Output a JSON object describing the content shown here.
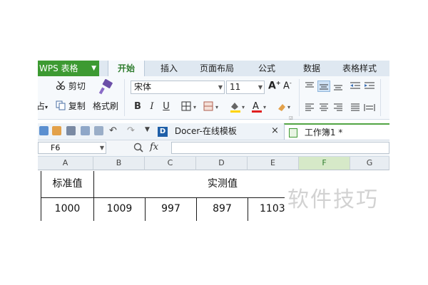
{
  "menubar": {
    "app_label": "WPS 表格",
    "tabs": [
      {
        "label": "开始"
      },
      {
        "label": "插入"
      },
      {
        "label": "页面布局"
      },
      {
        "label": "公式"
      },
      {
        "label": "数据"
      },
      {
        "label": "表格样式"
      }
    ]
  },
  "ribbon": {
    "cut_label": "剪切",
    "paste_label": "占",
    "copy_label": "复制",
    "format_painter_label": "格式刷",
    "font_name": "宋体",
    "font_size": "11"
  },
  "doc_tabs": {
    "docer_label": "Docer-在线模板",
    "close_glyph": "×",
    "workbook_label": "工作簿1 *"
  },
  "formula_bar": {
    "cell_ref": "F6",
    "fx_label": "fx"
  },
  "sheet": {
    "columns": [
      "A",
      "B",
      "C",
      "D",
      "E",
      "F",
      "G"
    ],
    "selected_column": "F",
    "header_row": {
      "standard": "标准值",
      "measured": "实测值"
    },
    "data_row": [
      "1000",
      "1009",
      "997",
      "897",
      "1103"
    ]
  },
  "watermark": "软件技巧",
  "colors": {
    "accent_green": "#3d9a32",
    "ribbon_bg": "#f6f9fc",
    "menu_bg": "#dfe8f1"
  }
}
